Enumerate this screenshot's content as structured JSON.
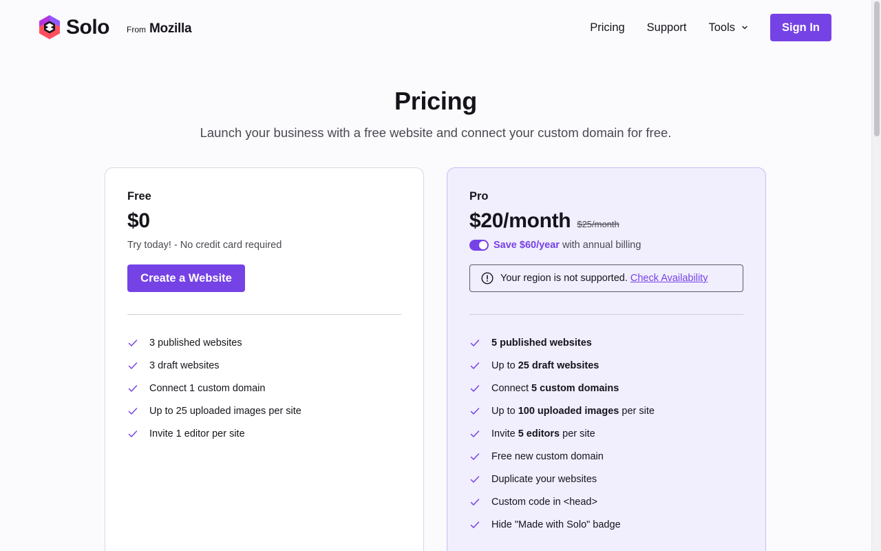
{
  "header": {
    "brand": "Solo",
    "from_label": "From",
    "parent_brand": "Mozilla",
    "nav": {
      "pricing": "Pricing",
      "support": "Support",
      "tools": "Tools"
    },
    "sign_in": "Sign In"
  },
  "hero": {
    "title": "Pricing",
    "subtitle": "Launch your business with a free website and connect your custom domain for free."
  },
  "plans": {
    "free": {
      "name": "Free",
      "price": "$0",
      "note": "Try today! - No credit card required",
      "cta": "Create a Website",
      "features": [
        "3 published websites",
        "3 draft websites",
        "Connect 1 custom domain",
        "Up to 25 uploaded images per site",
        "Invite 1 editor per site"
      ]
    },
    "pro": {
      "name": "Pro",
      "price": "$20/month",
      "old_price": "$25/month",
      "annual_billing_enabled": true,
      "save_text": "Save $60/year",
      "billing_suffix": "with annual billing",
      "region_message": "Your region is not supported.",
      "region_link": "Check Availability",
      "features": [
        {
          "pre": "",
          "bold": "5 published websites",
          "post": ""
        },
        {
          "pre": "Up to ",
          "bold": "25 draft websites",
          "post": ""
        },
        {
          "pre": "Connect ",
          "bold": "5 custom domains",
          "post": ""
        },
        {
          "pre": "Up to ",
          "bold": "100 uploaded images",
          "post": " per site"
        },
        {
          "pre": "Invite ",
          "bold": "5 editors",
          "post": " per site"
        },
        {
          "pre": "Free new custom domain",
          "bold": "",
          "post": ""
        },
        {
          "pre": "Duplicate your websites",
          "bold": "",
          "post": ""
        },
        {
          "pre": "Custom code in <head>",
          "bold": "",
          "post": ""
        },
        {
          "pre": "Hide \"Made with Solo\" badge",
          "bold": "",
          "post": ""
        }
      ]
    }
  },
  "colors": {
    "accent": "#7542e5",
    "pro_card_bg": "#f1eefe",
    "text": "#15141a"
  },
  "icons": [
    "solo-logo-icon",
    "chevron-down-icon",
    "check-icon",
    "alert-circle-icon"
  ]
}
